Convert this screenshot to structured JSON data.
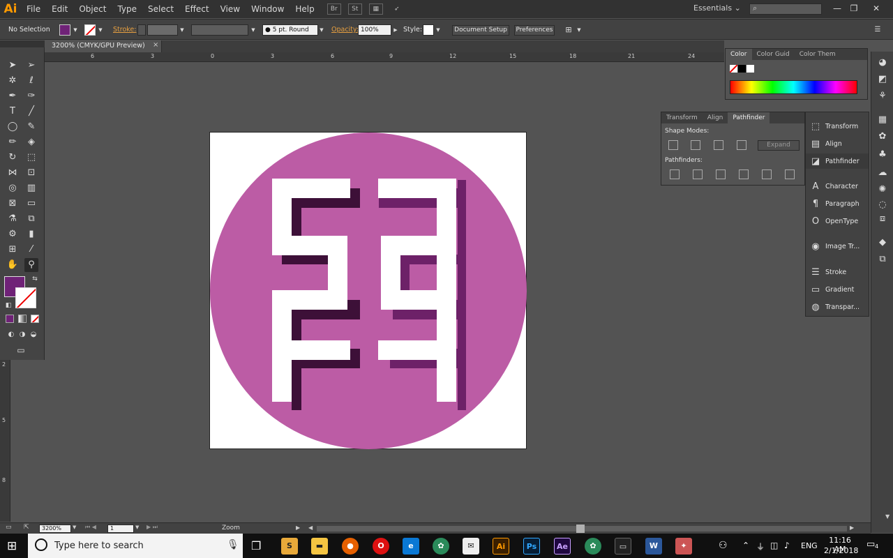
{
  "app": {
    "logo": "Ai",
    "menus": [
      "File",
      "Edit",
      "Object",
      "Type",
      "Select",
      "Effect",
      "View",
      "Window",
      "Help"
    ],
    "workspace": "Essentials",
    "workspace_caret": "⌄",
    "menu_icons": {
      "bridge": "Br",
      "stock": "St"
    }
  },
  "control_bar": {
    "selection": "No Selection",
    "stroke_label": "Stroke:",
    "brush": "5 pt. Round",
    "opacity_label": "Opacity:",
    "opacity_value": "100%",
    "style_label": "Style:",
    "document_setup": "Document Setup",
    "preferences": "Preferences",
    "fill_color": "#6f2277"
  },
  "document": {
    "tab_title": "3200% (CMYK/GPU Preview)",
    "close_glyph": "×",
    "ruler_top_labels": [
      "6",
      "3",
      "0",
      "3",
      "6",
      "9",
      "12",
      "15",
      "18",
      "21",
      "24"
    ],
    "ruler_left_labels": [
      "2",
      "5",
      "8"
    ]
  },
  "color_panel": {
    "tabs": [
      "Color",
      "Color Guid",
      "Color Them"
    ]
  },
  "pathfinder_panel": {
    "tabs": [
      "Transform",
      "Align",
      "Pathfinder"
    ],
    "shape_modes_label": "Shape Modes:",
    "pathfinders_label": "Pathfinders:",
    "expand_label": "Expand"
  },
  "dock": {
    "items": [
      "Transform",
      "Align",
      "Pathfinder",
      "Character",
      "Paragraph",
      "OpenType",
      "Image Tr...",
      "Stroke",
      "Gradient",
      "Transpar..."
    ]
  },
  "status_bar": {
    "zoom": "3200%",
    "artboard": "1",
    "mode": "Zoom"
  },
  "artwork": {
    "circle_color": "#bc5ca5",
    "shadow_color": "#3d1038",
    "shadow_color_2": "#6d2168",
    "glyph_color": "#ffffff"
  },
  "taskbar": {
    "search_placeholder": "Type here to search",
    "time": "11:16 AM",
    "date": "2/1/2018",
    "language": "ENG",
    "notifications": "4",
    "apps": {
      "illustrator": "Ai",
      "photoshop": "Ps",
      "after_effects": "Ae",
      "word": "W"
    }
  }
}
